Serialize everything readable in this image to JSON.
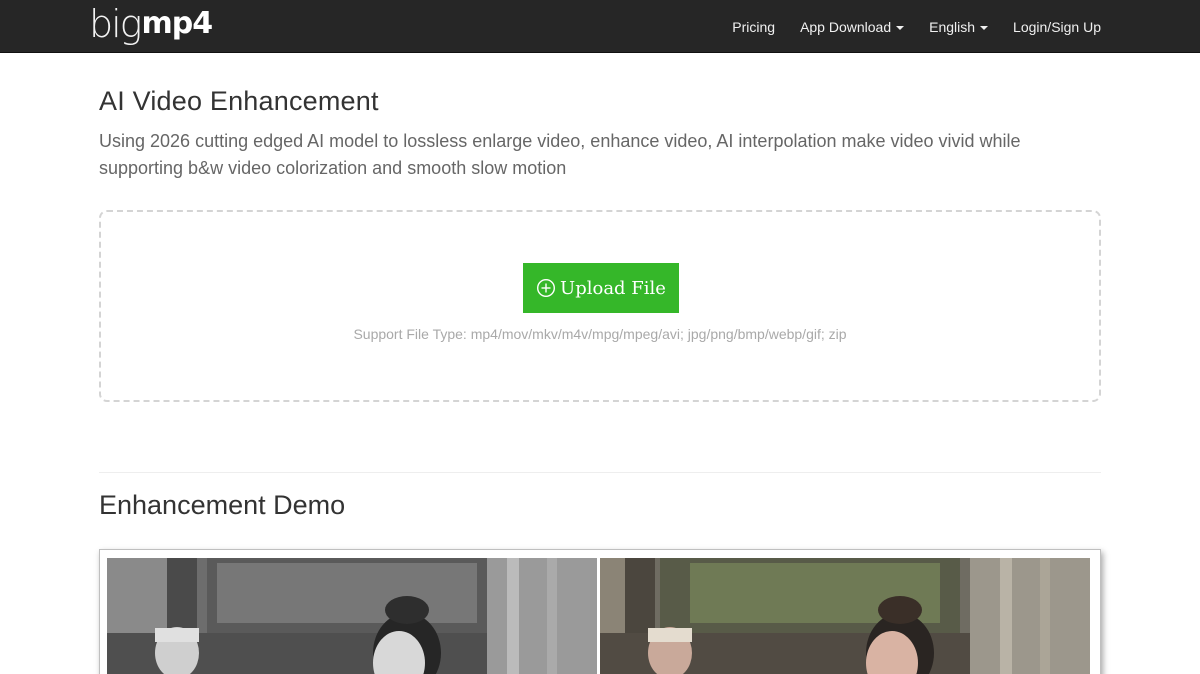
{
  "nav": {
    "logo_thin": "big",
    "logo_bold": "mp4",
    "links": [
      {
        "label": "Pricing"
      },
      {
        "label": "App Download"
      },
      {
        "label": "English"
      },
      {
        "label": "Login/Sign Up"
      }
    ]
  },
  "hero": {
    "title": "AI Video Enhancement",
    "description": "Using 2026 cutting edged AI model to lossless enlarge video, enhance video, AI interpolation make video vivid while supporting b&w video colorization and smooth slow motion"
  },
  "upload": {
    "button_label": "Upload File",
    "support_text": "Support File Type: mp4/mov/mkv/m4v/mpg/mpeg/avi; jpg/png/bmp/webp/gif; zip",
    "button_color": "#35b729"
  },
  "demo": {
    "title": "Enhancement Demo"
  },
  "icons": {
    "upload": "plus-circle-icon",
    "dropdown": "caret-down-icon"
  }
}
